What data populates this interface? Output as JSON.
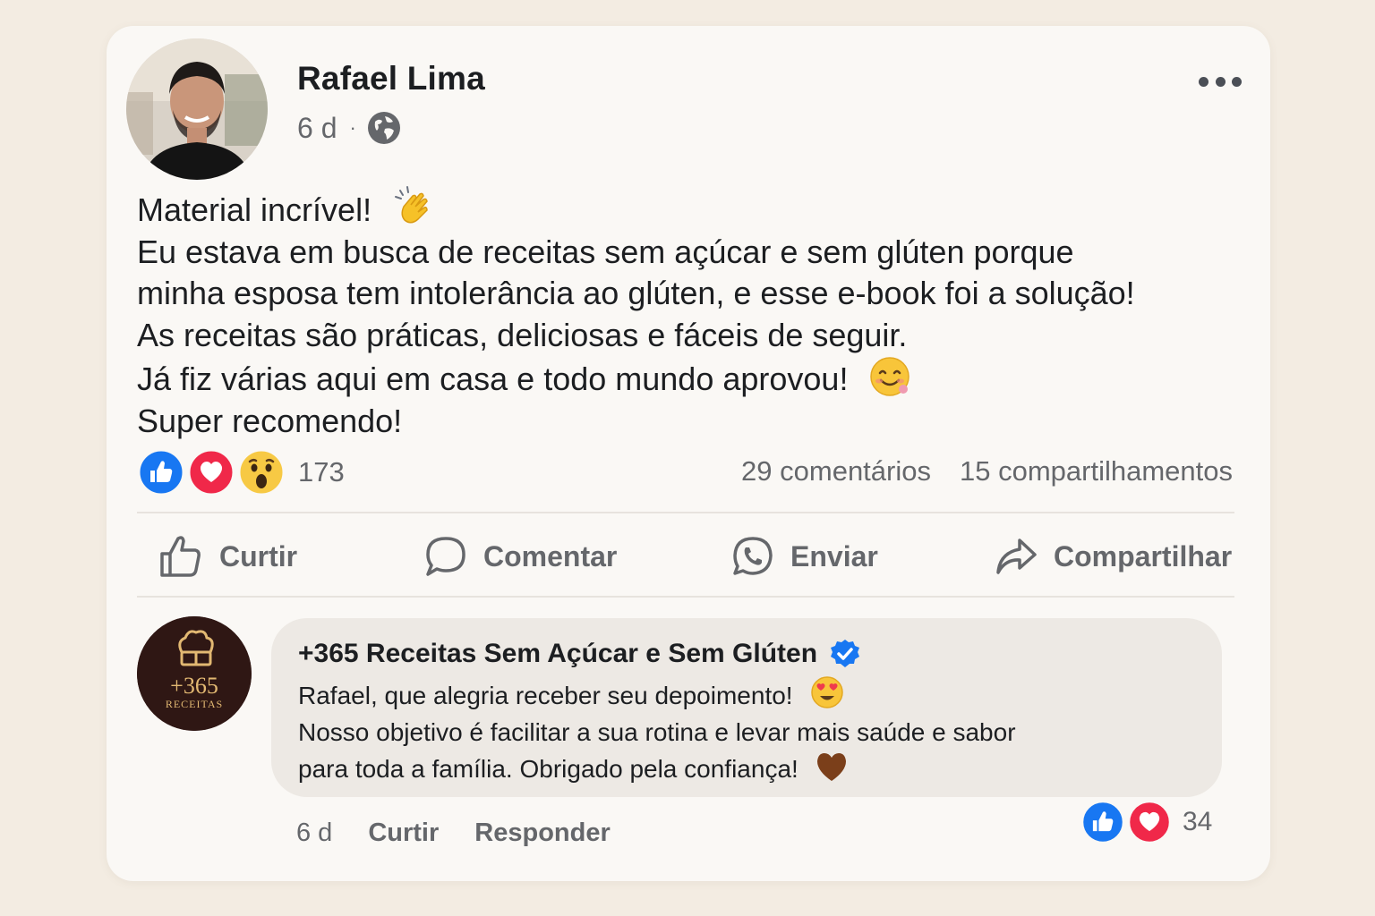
{
  "post": {
    "author": "Rafael Lima",
    "time": "6 d",
    "separator": "·",
    "privacy_icon": "globe-icon",
    "text_lines": [
      "Material incrível!",
      "Eu estava em busca de receitas sem açúcar e sem glúten porque",
      "minha esposa tem intolerância ao glúten, e esse e-book foi a solução!",
      "As receitas são práticas, deliciosas e fáceis de seguir.",
      "Já fiz várias aqui em casa e todo mundo aprovou!",
      "Super recomendo!"
    ],
    "reactions": [
      "like",
      "love",
      "wow"
    ],
    "reaction_count": "173",
    "comments": "29 comentários",
    "shares": "15 compartilhamentos"
  },
  "actions": {
    "like": "Curtir",
    "comment": "Comentar",
    "send": "Enviar",
    "share": "Compartilhar"
  },
  "reply": {
    "page_name": "+365 Receitas Sem Açúcar e Sem Glúten",
    "verified": true,
    "avatar_title": "+365",
    "avatar_subtitle": "RECEITAS",
    "text_lines": [
      "Rafael, que alegria receber seu depoimento!",
      "Nosso objetivo é facilitar a sua rotina e levar mais saúde e sabor",
      "para toda a família. Obrigado pela confiança!"
    ],
    "time": "6 d",
    "like_label": "Curtir",
    "reply_label": "Responder",
    "reactions": [
      "like",
      "love"
    ],
    "reaction_count": "34"
  },
  "colors": {
    "background": "#f3ece2",
    "card": "#faf8f5",
    "like_blue": "#1877f2",
    "love_red": "#f02849",
    "muted_text": "#65676b"
  }
}
